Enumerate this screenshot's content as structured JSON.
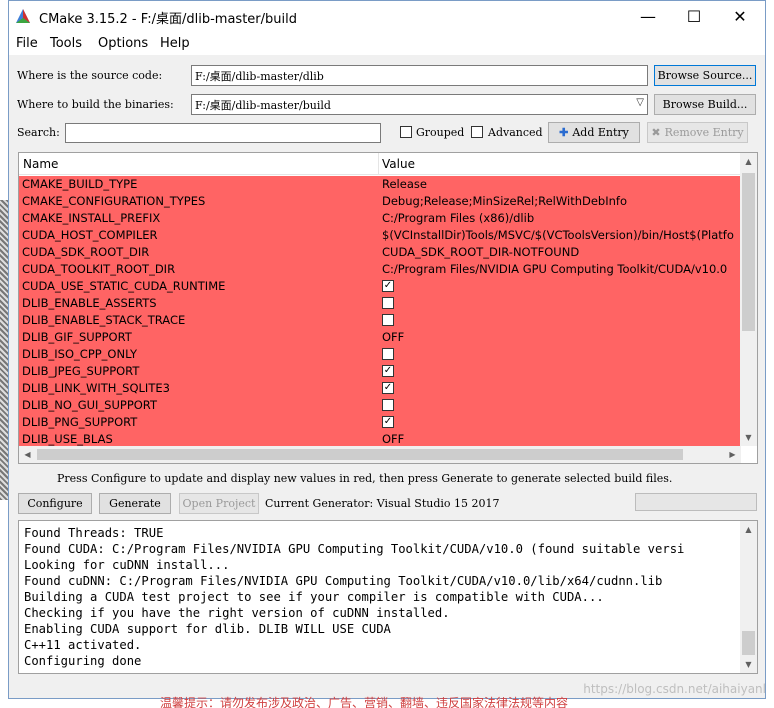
{
  "window": {
    "title": "CMake 3.15.2 - F:/桌面/dlib-master/build",
    "minimize_glyph": "—",
    "maximize_glyph": "☐",
    "close_glyph": "✕"
  },
  "menu": [
    "File",
    "Tools",
    "Options",
    "Help"
  ],
  "source": {
    "label": "Where is the source code:",
    "value": "F:/桌面/dlib-master/dlib",
    "browse_label": "Browse Source..."
  },
  "build": {
    "label": "Where to build the binaries:",
    "value": "F:/桌面/dlib-master/build",
    "browse_label": "Browse Build..."
  },
  "search": {
    "label": "Search:",
    "value": "",
    "grouped_label": "Grouped",
    "advanced_label": "Advanced",
    "add_entry_label": "Add Entry",
    "remove_entry_label": "Remove Entry"
  },
  "table": {
    "headers": [
      "Name",
      "Value"
    ],
    "rows": [
      {
        "name": "CMAKE_BUILD_TYPE",
        "value": "Release"
      },
      {
        "name": "CMAKE_CONFIGURATION_TYPES",
        "value": "Debug;Release;MinSizeRel;RelWithDebInfo"
      },
      {
        "name": "CMAKE_INSTALL_PREFIX",
        "value": "C:/Program Files (x86)/dlib"
      },
      {
        "name": "CUDA_HOST_COMPILER",
        "value": "$(VCInstallDir)Tools/MSVC/$(VCToolsVersion)/bin/Host$(Platfo"
      },
      {
        "name": "CUDA_SDK_ROOT_DIR",
        "value": "CUDA_SDK_ROOT_DIR-NOTFOUND"
      },
      {
        "name": "CUDA_TOOLKIT_ROOT_DIR",
        "value": "C:/Program Files/NVIDIA GPU Computing Toolkit/CUDA/v10.0"
      },
      {
        "name": "CUDA_USE_STATIC_CUDA_RUNTIME",
        "checkbox": true,
        "checked": true
      },
      {
        "name": "DLIB_ENABLE_ASSERTS",
        "checkbox": true,
        "checked": false
      },
      {
        "name": "DLIB_ENABLE_STACK_TRACE",
        "checkbox": true,
        "checked": false
      },
      {
        "name": "DLIB_GIF_SUPPORT",
        "value": "OFF"
      },
      {
        "name": "DLIB_ISO_CPP_ONLY",
        "checkbox": true,
        "checked": false
      },
      {
        "name": "DLIB_JPEG_SUPPORT",
        "checkbox": true,
        "checked": true
      },
      {
        "name": "DLIB_LINK_WITH_SQLITE3",
        "checkbox": true,
        "checked": true
      },
      {
        "name": "DLIB_NO_GUI_SUPPORT",
        "checkbox": true,
        "checked": false
      },
      {
        "name": "DLIB_PNG_SUPPORT",
        "checkbox": true,
        "checked": true
      },
      {
        "name": "DLIB_USE_BLAS",
        "value": "OFF"
      }
    ],
    "highlight_color": "#ff6464"
  },
  "status": {
    "message": "Press Configure to update and display new values in red, then press Generate to generate selected build files."
  },
  "actions": {
    "configure_label": "Configure",
    "generate_label": "Generate",
    "open_project_label": "Open Project",
    "generator_text": "Current Generator: Visual Studio 15 2017"
  },
  "output": {
    "lines": [
      "Found Threads: TRUE",
      "Found CUDA: C:/Program Files/NVIDIA GPU Computing Toolkit/CUDA/v10.0 (found suitable versi",
      "Looking for cuDNN install...",
      "Found cuDNN: C:/Program Files/NVIDIA GPU Computing Toolkit/CUDA/v10.0/lib/x64/cudnn.lib",
      "Building a CUDA test project to see if your compiler is compatible with CUDA...",
      "Checking if you have the right version of cuDNN installed.",
      "Enabling CUDA support for dlib.  DLIB WILL USE CUDA",
      "C++11 activated.",
      "Configuring done"
    ]
  },
  "watermark": "https://blog.csdn.net/aihaiyanl",
  "bottom_note": "温馨提示：请勿发布涉及政治、广告、营销、翻墙、违反国家法律法规等内容"
}
